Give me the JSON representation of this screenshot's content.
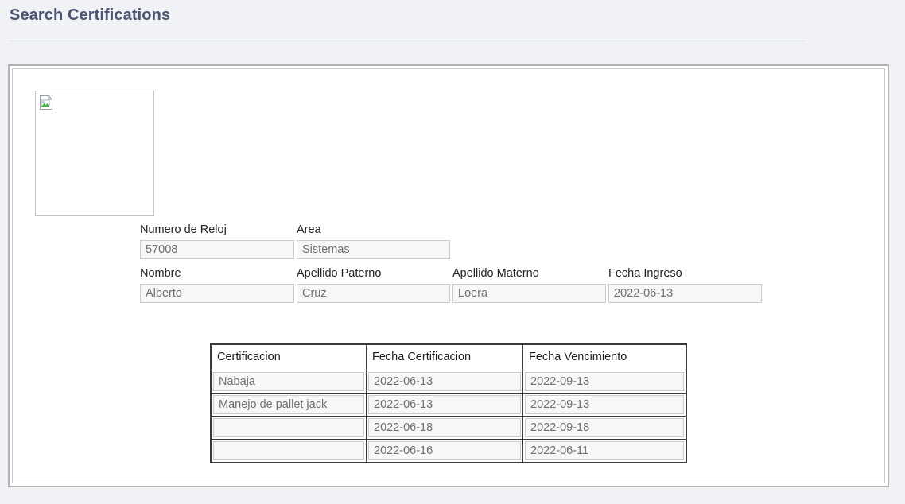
{
  "page": {
    "title": "Search Certifications"
  },
  "photo": {
    "icon": "broken-image-icon",
    "alt": ""
  },
  "form": {
    "fields": [
      {
        "label": "Numero de Reloj",
        "value": "57008"
      },
      {
        "label": "Area",
        "value": "Sistemas"
      },
      {
        "label": "Nombre",
        "value": "Alberto"
      },
      {
        "label": "Apellido Paterno",
        "value": "Cruz"
      },
      {
        "label": "Apellido Materno",
        "value": "Loera"
      },
      {
        "label": "Fecha Ingreso",
        "value": "2022-06-13"
      }
    ]
  },
  "certifications_table": {
    "headers": [
      "Certificacion",
      "Fecha Certificacion",
      "Fecha Vencimiento"
    ],
    "rows": [
      {
        "certificacion": "Nabaja",
        "fecha_certificacion": "2022-06-13",
        "fecha_vencimiento": "2022-09-13"
      },
      {
        "certificacion": "Manejo de pallet jack",
        "fecha_certificacion": "2022-06-13",
        "fecha_vencimiento": "2022-09-13"
      },
      {
        "certificacion": "",
        "fecha_certificacion": "2022-06-18",
        "fecha_vencimiento": "2022-09-18"
      },
      {
        "certificacion": "",
        "fecha_certificacion": "2022-06-16",
        "fecha_vencimiento": "2022-06-11"
      }
    ]
  },
  "colors": {
    "page_background": "#f1f2f6",
    "title": "#4c5673",
    "panel_border": "#b3b3b3",
    "input_background": "#f7f7f7",
    "input_border": "#cccccc",
    "input_text": "#6f6f6f",
    "table_border": "#3a3a3a"
  }
}
